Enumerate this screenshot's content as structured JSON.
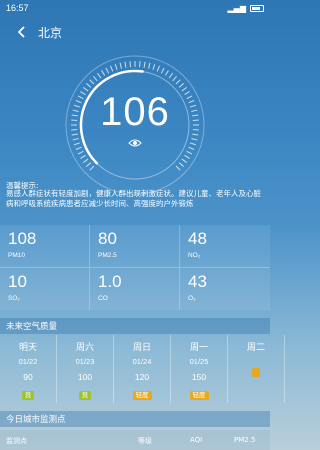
{
  "status_bar": {
    "time": "16:57",
    "indicators": "⚬ ⚙ ▮"
  },
  "header": {
    "city": "北京"
  },
  "aqi": {
    "value": "106",
    "gauge_fraction": 0.53
  },
  "tip": {
    "title": "温馨提示:",
    "text": "易感人群症状有轻度加剧，健康人群出现刺激症状。建议儿童、老年人及心脏病和呼吸系统疾病患者应减少长时间、高强度的户外锻炼"
  },
  "pollutants": [
    {
      "value": "108",
      "name": "PM10"
    },
    {
      "value": "80",
      "name": "PM2.5"
    },
    {
      "value": "48",
      "name": "NO₂"
    },
    {
      "value": "10",
      "name": "SO₂"
    },
    {
      "value": "1.0",
      "name": "CO"
    },
    {
      "value": "43",
      "name": "O₃"
    }
  ],
  "forecast_title": "未来空气质量",
  "forecast": [
    {
      "weekday": "明天",
      "date": "01/22",
      "aqi": "90",
      "level": "良",
      "level_color": "#9cc42e"
    },
    {
      "weekday": "周六",
      "date": "01/23",
      "aqi": "100",
      "level": "良",
      "level_color": "#9cc42e"
    },
    {
      "weekday": "周日",
      "date": "01/24",
      "aqi": "120",
      "level": "轻度",
      "level_color": "#e8a91c"
    },
    {
      "weekday": "周一",
      "date": "01/25",
      "aqi": "150",
      "level": "轻度",
      "level_color": "#e8a91c"
    },
    {
      "weekday": "周二",
      "date": "",
      "aqi": "",
      "level": "",
      "level_color": "#e8a91c"
    }
  ],
  "stations_title": "今日城市监测点",
  "station_columns": [
    "监测点",
    "等级",
    "AQI",
    "PM2.5"
  ]
}
